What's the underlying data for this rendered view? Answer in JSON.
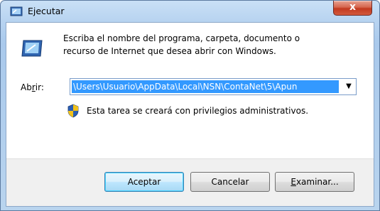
{
  "window": {
    "title": "Ejecutar",
    "close_glyph": "x"
  },
  "description": {
    "line1": "Escriba el nombre del programa, carpeta, documento o",
    "line2": "recurso de Internet que desea abrir con Windows."
  },
  "open": {
    "label_pre": "Ab",
    "label_u": "r",
    "label_post": "ir:",
    "value": "\\Users\\Usuario\\AppData\\Local\\NSN\\ContaNet\\5\\Apun"
  },
  "note": "Esta tarea se creará con privilegios administrativos.",
  "buttons": {
    "ok": "Aceptar",
    "cancel": "Cancelar",
    "browse_u": "E",
    "browse_rest": "xaminar..."
  },
  "icons": {
    "title": "run-icon",
    "run": "run-icon",
    "shield": "shield-icon",
    "dropdown": "chevron-down-icon"
  }
}
